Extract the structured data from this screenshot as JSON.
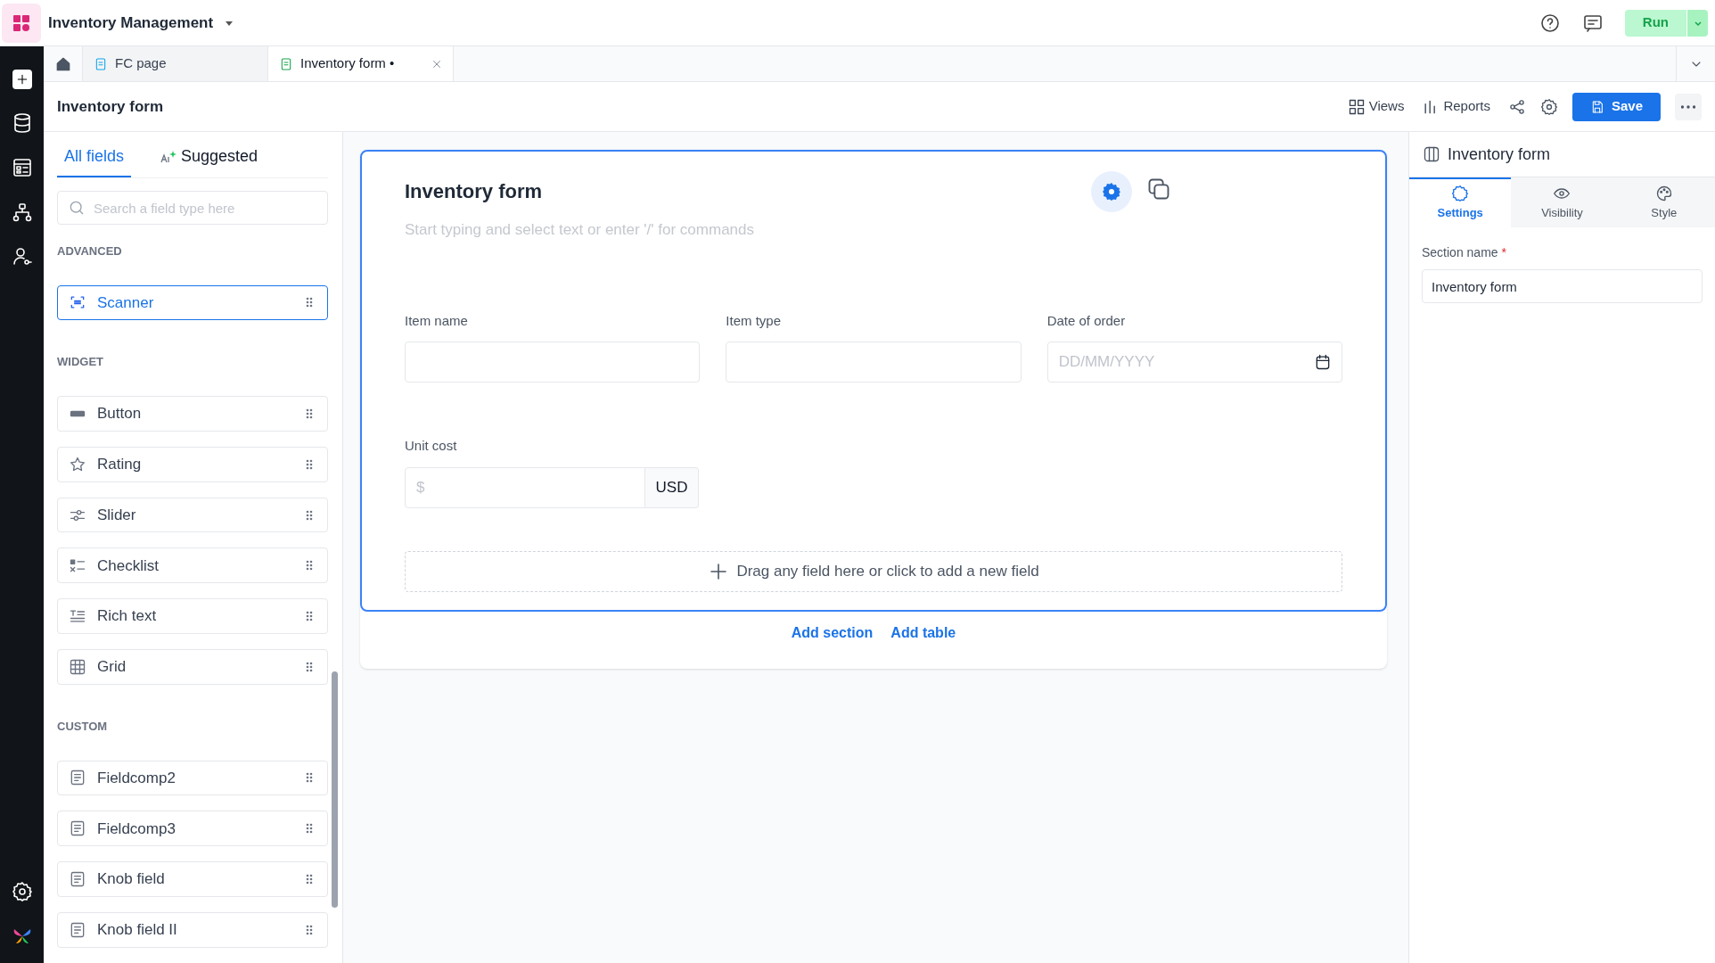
{
  "app": {
    "title": "Inventory Management",
    "run_label": "Run"
  },
  "doc_tabs": [
    {
      "label": "FC page",
      "selected": false
    },
    {
      "label": "Inventory form •",
      "selected": true
    }
  ],
  "page_header": {
    "title": "Inventory form",
    "actions": [
      "Views",
      "Reports"
    ],
    "save_label": "Save"
  },
  "left_panel": {
    "tabs": [
      {
        "label": "All fields",
        "selected": true
      },
      {
        "label": "Suggested",
        "selected": false
      }
    ],
    "search": {
      "placeholder": "Search a field type here"
    },
    "groups": [
      {
        "heading": "ADVANCED",
        "items": [
          {
            "label": "Scanner",
            "kind": "scanner",
            "selected": true
          }
        ]
      },
      {
        "heading": "WIDGET",
        "items": [
          {
            "label": "Button",
            "kind": "button",
            "selected": false
          },
          {
            "label": "Rating",
            "kind": "rating",
            "selected": false
          },
          {
            "label": "Slider",
            "kind": "slider",
            "selected": false
          },
          {
            "label": "Checklist",
            "kind": "checklist",
            "selected": false
          },
          {
            "label": "Rich text",
            "kind": "richtext",
            "selected": false
          },
          {
            "label": "Grid",
            "kind": "grid",
            "selected": false
          }
        ]
      },
      {
        "heading": "CUSTOM",
        "items": [
          {
            "label": "Fieldcomp2",
            "kind": "custom",
            "selected": false
          },
          {
            "label": "Fieldcomp3",
            "kind": "custom",
            "selected": false
          },
          {
            "label": "Knob field",
            "kind": "custom",
            "selected": false
          },
          {
            "label": "Knob field II",
            "kind": "custom",
            "selected": false
          }
        ]
      }
    ]
  },
  "form": {
    "title": "Inventory form",
    "description_placeholder": "Start typing and select text or enter '/' for commands",
    "fields": [
      {
        "label": "Item name",
        "kind": "text"
      },
      {
        "label": "Item type",
        "kind": "text"
      },
      {
        "label": "Date of order",
        "kind": "date",
        "placeholder": "DD/MM/YYYY"
      },
      {
        "label": "Unit cost",
        "kind": "currency",
        "placeholder": "$",
        "suffix": "USD"
      }
    ],
    "drop_zone": "Drag any field here or click to add a new field",
    "links": [
      "Add section",
      "Add table"
    ]
  },
  "right_panel": {
    "title": "Inventory form",
    "tabs": [
      {
        "label": "Settings",
        "kind": "settings",
        "selected": true
      },
      {
        "label": "Visibility",
        "kind": "visibility",
        "selected": false
      },
      {
        "label": "Style",
        "kind": "style",
        "selected": false
      }
    ],
    "field": {
      "label": "Section name",
      "required_mark": "*",
      "value": "Inventory form"
    }
  }
}
